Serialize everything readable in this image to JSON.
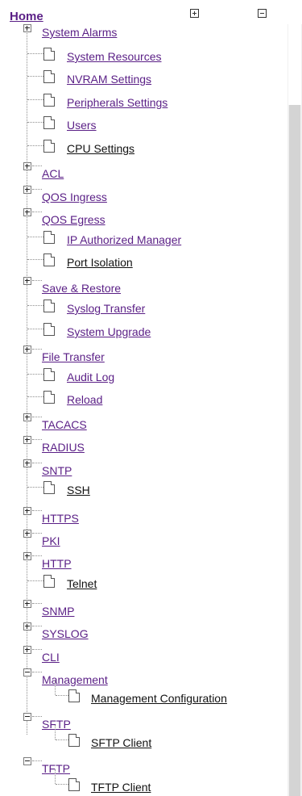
{
  "header": {
    "home_label": "Home"
  },
  "tree": {
    "items": [
      {
        "label": "System Alarms",
        "type": "folder",
        "state": "expanded",
        "interact": true
      },
      {
        "label": "System Resources",
        "type": "page"
      },
      {
        "label": "NVRAM Settings",
        "type": "page"
      },
      {
        "label": "Peripherals Settings",
        "type": "page"
      },
      {
        "label": "Users",
        "type": "page"
      },
      {
        "label": "CPU Settings",
        "type": "page",
        "current": true
      },
      {
        "label": "ACL",
        "type": "folder",
        "state": "collapsed"
      },
      {
        "label": "QOS Ingress",
        "type": "folder",
        "state": "collapsed"
      },
      {
        "label": "QOS Egress",
        "type": "folder",
        "state": "collapsed"
      },
      {
        "label": "IP Authorized Manager",
        "type": "page"
      },
      {
        "label": "Port Isolation",
        "type": "page",
        "current": true
      },
      {
        "label": "Save & Restore",
        "type": "folder",
        "state": "collapsed"
      },
      {
        "label": "Syslog Transfer",
        "type": "page"
      },
      {
        "label": "System Upgrade",
        "type": "page"
      },
      {
        "label": "File Transfer",
        "type": "folder",
        "state": "collapsed"
      },
      {
        "label": "Audit Log",
        "type": "page"
      },
      {
        "label": "Reload",
        "type": "page"
      },
      {
        "label": "TACACS",
        "type": "folder",
        "state": "collapsed"
      },
      {
        "label": "RADIUS",
        "type": "folder",
        "state": "collapsed"
      },
      {
        "label": "SNTP",
        "type": "folder",
        "state": "collapsed"
      },
      {
        "label": "SSH",
        "type": "page",
        "current": true
      },
      {
        "label": "HTTPS",
        "type": "folder",
        "state": "collapsed"
      },
      {
        "label": "PKI",
        "type": "folder",
        "state": "collapsed"
      },
      {
        "label": "HTTP",
        "type": "folder",
        "state": "collapsed"
      },
      {
        "label": "Telnet",
        "type": "page",
        "current": true
      },
      {
        "label": "SNMP",
        "type": "folder",
        "state": "collapsed"
      },
      {
        "label": "SYSLOG",
        "type": "folder",
        "state": "collapsed"
      },
      {
        "label": "CLI",
        "type": "folder",
        "state": "collapsed"
      },
      {
        "label": "Management",
        "type": "folder",
        "state": "expanded"
      },
      {
        "label": "Management Configuration",
        "type": "page",
        "level": 2,
        "current": true
      },
      {
        "label": "SFTP",
        "type": "folder",
        "state": "expanded"
      },
      {
        "label": "SFTP Client",
        "type": "page",
        "level": 2,
        "current": true
      },
      {
        "label": "TFTP",
        "type": "folder",
        "state": "expanded"
      },
      {
        "label": "TFTP Client",
        "type": "page",
        "level": 2,
        "current": true
      }
    ]
  }
}
